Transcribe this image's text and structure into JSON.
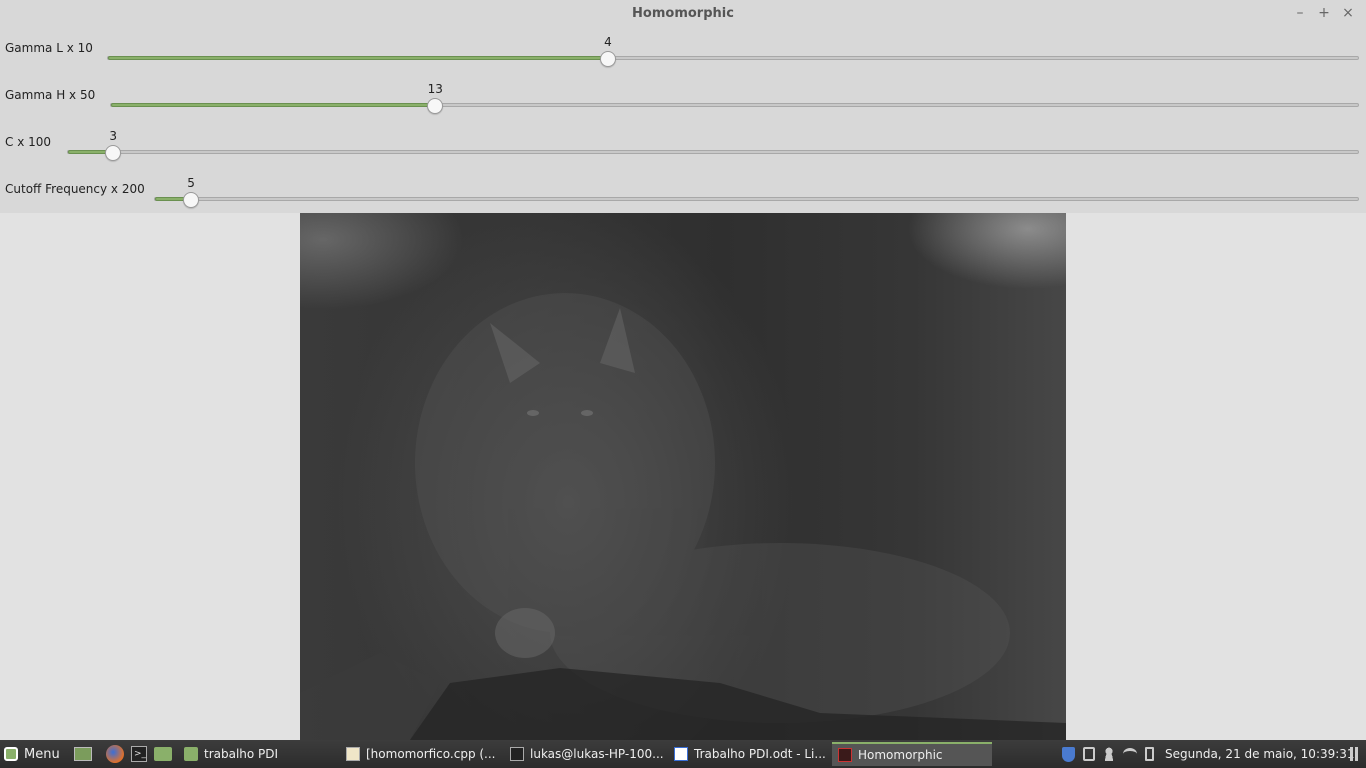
{
  "window": {
    "title": "Homomorphic",
    "buttons": [
      "–",
      "+",
      "×"
    ]
  },
  "trackbars": [
    {
      "label": "Gamma L x 10",
      "value": "4",
      "fraction": 0.4
    },
    {
      "label": "Gamma H x 50",
      "value": "13",
      "fraction": 0.26
    },
    {
      "label": "C x 100",
      "value": "3",
      "fraction": 0.035
    },
    {
      "label": "Cutoff Frequency x 200",
      "value": "5",
      "fraction": 0.03
    }
  ],
  "taskbar": {
    "menu_label": "Menu",
    "tasks": [
      {
        "label": "trabalho PDI",
        "icon": "folder-icon"
      },
      {
        "label": "[homomorfico.cpp (...",
        "icon": "text-editor-icon"
      },
      {
        "label": "lukas@lukas-HP-100...",
        "icon": "terminal-icon"
      },
      {
        "label": "Trabalho PDI.odt - Li...",
        "icon": "document-icon"
      },
      {
        "label": "Homomorphic",
        "icon": "app-window-icon"
      }
    ],
    "clock": "Segunda, 21 de maio, 10:39:31"
  },
  "colors": {
    "accent": "#8ab06a",
    "panel": "#d8d8d8",
    "taskbar": "#2c2c2c"
  }
}
